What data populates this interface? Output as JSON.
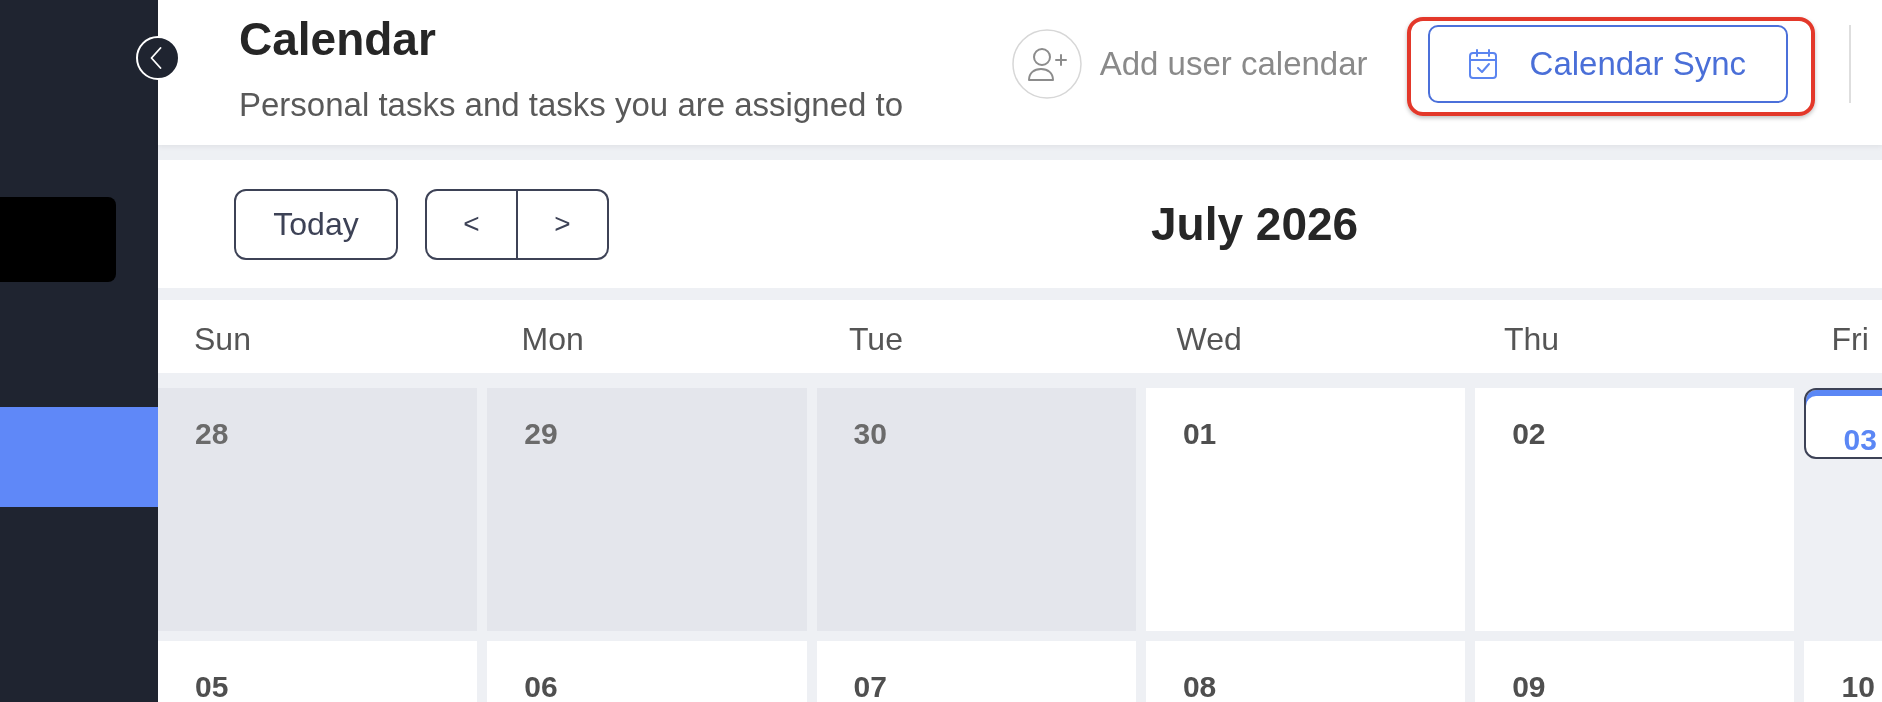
{
  "sidebar": {
    "items": [
      {
        "selected": true
      }
    ]
  },
  "header": {
    "title": "Calendar",
    "subtitle": "Personal tasks and tasks you are assigned to",
    "add_user_calendar": {
      "label": "Add user calendar"
    },
    "calendar_sync": {
      "label": "Calendar Sync",
      "highlighted": true
    }
  },
  "toolbar": {
    "today_button": {
      "label": "Today"
    },
    "prev_button": {
      "label": "<"
    },
    "next_button": {
      "label": ">"
    },
    "month_title": "July 2026"
  },
  "calendar": {
    "weekdays": [
      "Sun",
      "Mon",
      "Tue",
      "Wed",
      "Thu",
      "Fri"
    ],
    "weeks": [
      [
        {
          "day": "28",
          "in_month": false,
          "today": false
        },
        {
          "day": "29",
          "in_month": false,
          "today": false
        },
        {
          "day": "30",
          "in_month": false,
          "today": false
        },
        {
          "day": "01",
          "in_month": true,
          "today": false
        },
        {
          "day": "02",
          "in_month": true,
          "today": false
        },
        {
          "day": "03",
          "in_month": true,
          "today": true
        }
      ],
      [
        {
          "day": "05",
          "in_month": true,
          "today": false
        },
        {
          "day": "06",
          "in_month": true,
          "today": false
        },
        {
          "day": "07",
          "in_month": true,
          "today": false
        },
        {
          "day": "08",
          "in_month": true,
          "today": false
        },
        {
          "day": "09",
          "in_month": true,
          "today": false
        },
        {
          "day": "10",
          "in_month": true,
          "today": false
        }
      ]
    ]
  }
}
